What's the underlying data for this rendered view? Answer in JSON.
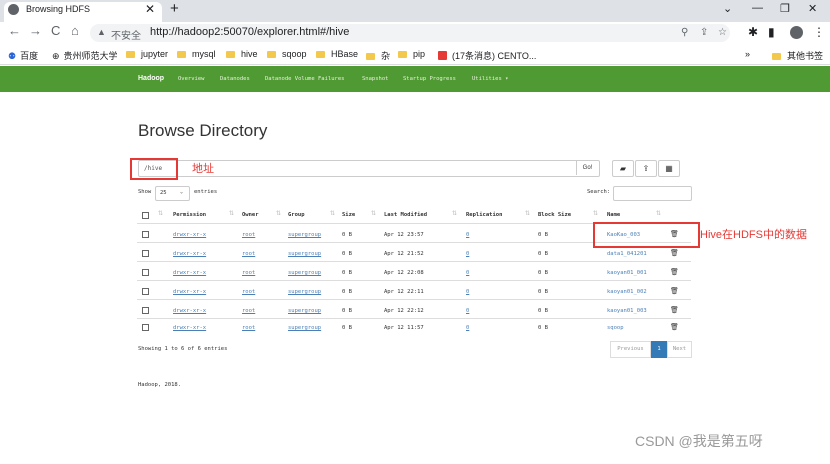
{
  "browser": {
    "tab_title": "Browsing HDFS",
    "tab_close": "✕",
    "new_tab": "+",
    "window_controls": [
      "⌄",
      "—",
      "❐",
      "✕"
    ],
    "nav": {
      "back": "←",
      "forward": "→",
      "reload": "C",
      "home": "⌂"
    },
    "security_icon": "▲",
    "security_label": "不安全",
    "url": "http://hadoop2:50070/explorer.html#/hive",
    "omnibox_icons": [
      "⚲",
      "⇪",
      "☆"
    ],
    "toolbar_icons": [
      "✱",
      "▮"
    ],
    "menu": "⋮",
    "bookmarks": [
      "百度",
      "贵州师范大学",
      "jupyter",
      "mysql",
      "hive",
      "sqoop",
      "HBase",
      "杂",
      "pip",
      "(17条消息) CENTO..."
    ],
    "bookmarks_right": "其他书签",
    "bookmarks_overflow": "»"
  },
  "hadoop_nav": {
    "brand": "Hadoop",
    "items": [
      "Overview",
      "Datanodes",
      "Datanode Volume Failures",
      "Snapshot",
      "Startup Progress",
      "Utilities ▾"
    ]
  },
  "page_title": "Browse Directory",
  "path_value": "/hive",
  "go_label": "Go!",
  "tool_icons": [
    "▰",
    "⇪",
    "▦"
  ],
  "annotations": {
    "path": "地址",
    "data": "Hive在HDFS中的数据"
  },
  "show_label": "Show",
  "entries_select": "25",
  "entries_label": "entries",
  "search_label": "Search:",
  "table": {
    "headers": [
      "Permission",
      "Owner",
      "Group",
      "Size",
      "Last Modified",
      "Replication",
      "Block Size",
      "Name"
    ],
    "rows": [
      {
        "permission": "drwxr-xr-x",
        "owner": "root",
        "group": "supergroup",
        "size": "0 B",
        "modified": "Apr 12 23:57",
        "replication": "0",
        "block": "0 B",
        "name": "KaoKao_003"
      },
      {
        "permission": "drwxr-xr-x",
        "owner": "root",
        "group": "supergroup",
        "size": "0 B",
        "modified": "Apr 12 21:52",
        "replication": "0",
        "block": "0 B",
        "name": "data1_041201"
      },
      {
        "permission": "drwxr-xr-x",
        "owner": "root",
        "group": "supergroup",
        "size": "0 B",
        "modified": "Apr 12 22:08",
        "replication": "0",
        "block": "0 B",
        "name": "kaoyan01_001"
      },
      {
        "permission": "drwxr-xr-x",
        "owner": "root",
        "group": "supergroup",
        "size": "0 B",
        "modified": "Apr 12 22:11",
        "replication": "0",
        "block": "0 B",
        "name": "kaoyan01_002"
      },
      {
        "permission": "drwxr-xr-x",
        "owner": "root",
        "group": "supergroup",
        "size": "0 B",
        "modified": "Apr 12 22:12",
        "replication": "0",
        "block": "0 B",
        "name": "kaoyan01_003"
      },
      {
        "permission": "drwxr-xr-x",
        "owner": "root",
        "group": "supergroup",
        "size": "0 B",
        "modified": "Apr 12 11:57",
        "replication": "0",
        "block": "0 B",
        "name": "sqoop"
      }
    ]
  },
  "showing_text": "Showing 1 to 6 of 6 entries",
  "pagination": {
    "previous": "Previous",
    "page": "1",
    "next": "Next"
  },
  "footer": "Hadoop, 2018.",
  "watermark": "CSDN @我是第五呀",
  "colors": {
    "nav_green": "#4f9a32",
    "link": "#4a7fb8",
    "annotation_red": "#e53935",
    "pagination_active": "#337ab7"
  }
}
